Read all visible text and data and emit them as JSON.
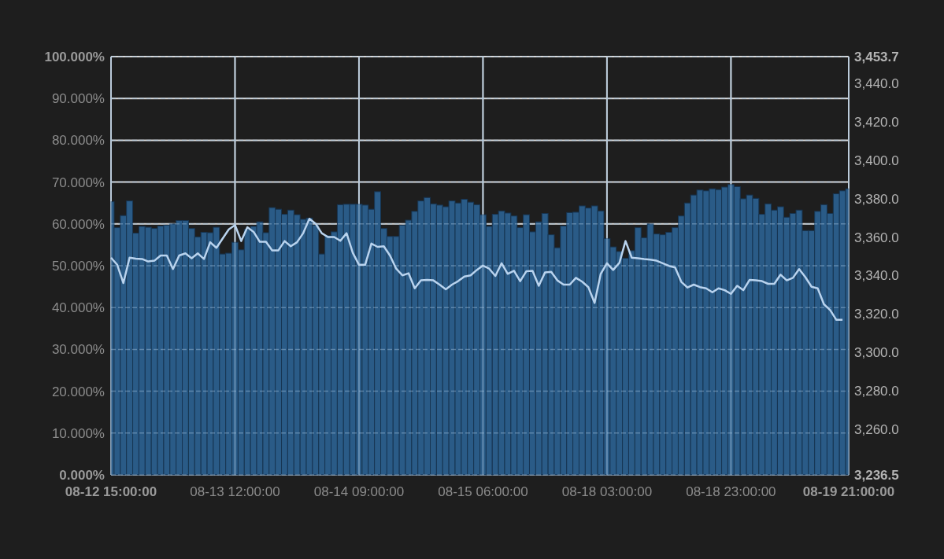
{
  "chart_data": {
    "type": "bar",
    "grid": true,
    "categories": [
      "08-12 15:00:00",
      null,
      null,
      null,
      null,
      null,
      null,
      null,
      null,
      null,
      null,
      null,
      null,
      null,
      null,
      null,
      null,
      null,
      null,
      null,
      "08-13 12:00:00",
      null,
      null,
      null,
      null,
      null,
      null,
      null,
      null,
      null,
      null,
      null,
      null,
      null,
      null,
      null,
      null,
      null,
      null,
      null,
      "08-14 09:00:00",
      null,
      null,
      null,
      null,
      null,
      null,
      null,
      null,
      null,
      null,
      null,
      null,
      null,
      null,
      null,
      null,
      null,
      null,
      null,
      "08-15 06:00:00",
      null,
      null,
      null,
      null,
      null,
      null,
      null,
      null,
      null,
      null,
      null,
      null,
      null,
      null,
      null,
      null,
      null,
      null,
      null,
      "08-18 03:00:00",
      null,
      null,
      null,
      null,
      null,
      null,
      null,
      null,
      null,
      null,
      null,
      null,
      null,
      null,
      null,
      null,
      null,
      null,
      null,
      "08-18 23:00:00",
      null,
      null,
      null,
      null,
      null,
      null,
      null,
      null,
      null,
      null,
      null,
      null,
      null,
      null,
      null,
      null,
      null,
      null,
      "08-19 21:00:00"
    ],
    "ylim": [
      0,
      100
    ],
    "yticks": [
      {
        "value": 0,
        "label": "0.000%"
      },
      {
        "value": 10,
        "label": "10.000%"
      },
      {
        "value": 20,
        "label": "20.000%"
      },
      {
        "value": 30,
        "label": "30.000%"
      },
      {
        "value": 40,
        "label": "40.000%"
      },
      {
        "value": 50,
        "label": "50.000%"
      },
      {
        "value": 60,
        "label": "60.000%"
      },
      {
        "value": 70,
        "label": "70.000%"
      },
      {
        "value": 80,
        "label": "80.000%"
      },
      {
        "value": 90,
        "label": "90.000%"
      },
      {
        "value": 100,
        "label": "100.000%"
      }
    ],
    "y2lim": [
      3236.5,
      3453.7
    ],
    "y2ticks": [
      {
        "value": 3236.5,
        "label": "3,236.5"
      },
      {
        "value": 3260,
        "label": "3,260.0"
      },
      {
        "value": 3280,
        "label": "3,280.0"
      },
      {
        "value": 3300,
        "label": "3,300.0"
      },
      {
        "value": 3320,
        "label": "3,320.0"
      },
      {
        "value": 3340,
        "label": "3,340.0"
      },
      {
        "value": 3360,
        "label": "3,360.0"
      },
      {
        "value": 3380,
        "label": "3,380.0"
      },
      {
        "value": 3400,
        "label": "3,400.0"
      },
      {
        "value": 3420,
        "label": "3,420.0"
      },
      {
        "value": 3440,
        "label": "3,440.0"
      },
      {
        "value": 3453.7,
        "label": "3,453.7"
      }
    ],
    "series": [
      {
        "color": "#2a5b87",
        "values": [
          65.3,
          59.1,
          62.0,
          65.5,
          57.8,
          59.4,
          59.2,
          58.9,
          59.5,
          59.7,
          60.0,
          60.8,
          60.8,
          58.9,
          56.9,
          58.0,
          57.9,
          59.2,
          52.8,
          53.0,
          55.6,
          53.8,
          58.7,
          59.4,
          60.5,
          57.9,
          63.9,
          63.5,
          62.3,
          63.3,
          62.2,
          61.1,
          61.4,
          59.7,
          52.8,
          57.2,
          58.1,
          64.6,
          64.7,
          64.7,
          64.7,
          64.5,
          63.5,
          67.7,
          58.9,
          57.0,
          57.0,
          59.7,
          60.9,
          63.0,
          65.5,
          66.3,
          64.8,
          64.5,
          64.1,
          65.5,
          65.0,
          65.9,
          65.2,
          64.6,
          62.2,
          59.4,
          62.3,
          63.1,
          62.6,
          61.9,
          59.1,
          62.2,
          58.1,
          60.5,
          62.5,
          57.4,
          54.3,
          59.5,
          62.7,
          62.8,
          64.3,
          63.8,
          64.3,
          63.1,
          56.5,
          54.5,
          53.4,
          51.8,
          53.6,
          59.1,
          56.7,
          60.0,
          57.6,
          57.4,
          58.0,
          59.1,
          61.9,
          65.0,
          66.9,
          68.1,
          67.9,
          68.4,
          68.2,
          68.8,
          69.4,
          68.9,
          66.0,
          66.9,
          66.1,
          62.3,
          64.8,
          63.3,
          64.1,
          61.6,
          62.5,
          63.3,
          58.4,
          58.4,
          63.0,
          64.6,
          62.5,
          67.2,
          67.9,
          68.4
        ]
      },
      {
        "type": "line",
        "axis": "y2",
        "color": "#b9d3ee",
        "values": [
          3349.3,
          3345.6,
          3336.1,
          3349.3,
          3348.8,
          3348.6,
          3347.3,
          3347.7,
          3350.4,
          3350.4,
          3343.4,
          3350.4,
          3351.5,
          3349.0,
          3351.5,
          3348.6,
          3357.3,
          3354.4,
          3359.2,
          3364.0,
          3366.2,
          3357.9,
          3365.1,
          3362.7,
          3357.5,
          3357.5,
          3353.1,
          3353.1,
          3357.9,
          3355.2,
          3357.3,
          3362.0,
          3369.5,
          3367.0,
          3362.0,
          3360.0,
          3360.0,
          3358.1,
          3362.0,
          3351.8,
          3345.6,
          3345.6,
          3356.6,
          3354.9,
          3355.2,
          3350.4,
          3343.6,
          3340.1,
          3341.2,
          3333.4,
          3337.5,
          3337.7,
          3337.5,
          3335.3,
          3332.9,
          3335.3,
          3337.1,
          3339.5,
          3340.1,
          3342.9,
          3345.2,
          3343.6,
          3339.8,
          3346.4,
          3340.9,
          3342.5,
          3337.1,
          3342.3,
          3342.5,
          3334.7,
          3341.6,
          3341.9,
          3337.5,
          3335.3,
          3335.3,
          3338.8,
          3336.8,
          3334.0,
          3325.8,
          3340.9,
          3346.4,
          3342.9,
          3346.6,
          3357.9,
          3349.3,
          3349.0,
          3348.6,
          3348.3,
          3347.7,
          3346.4,
          3345.0,
          3344.2,
          3336.7,
          3333.8,
          3335.3,
          3334.0,
          3333.4,
          3331.3,
          3333.4,
          3332.4,
          3330.5,
          3334.7,
          3332.4,
          3337.7,
          3337.5,
          3337.1,
          3335.7,
          3335.7,
          3340.5,
          3337.5,
          3338.8,
          3343.4,
          3339.2,
          3334.2,
          3333.4,
          3325.1,
          3322.1,
          3317.0,
          3317.0,
          null
        ]
      }
    ]
  }
}
